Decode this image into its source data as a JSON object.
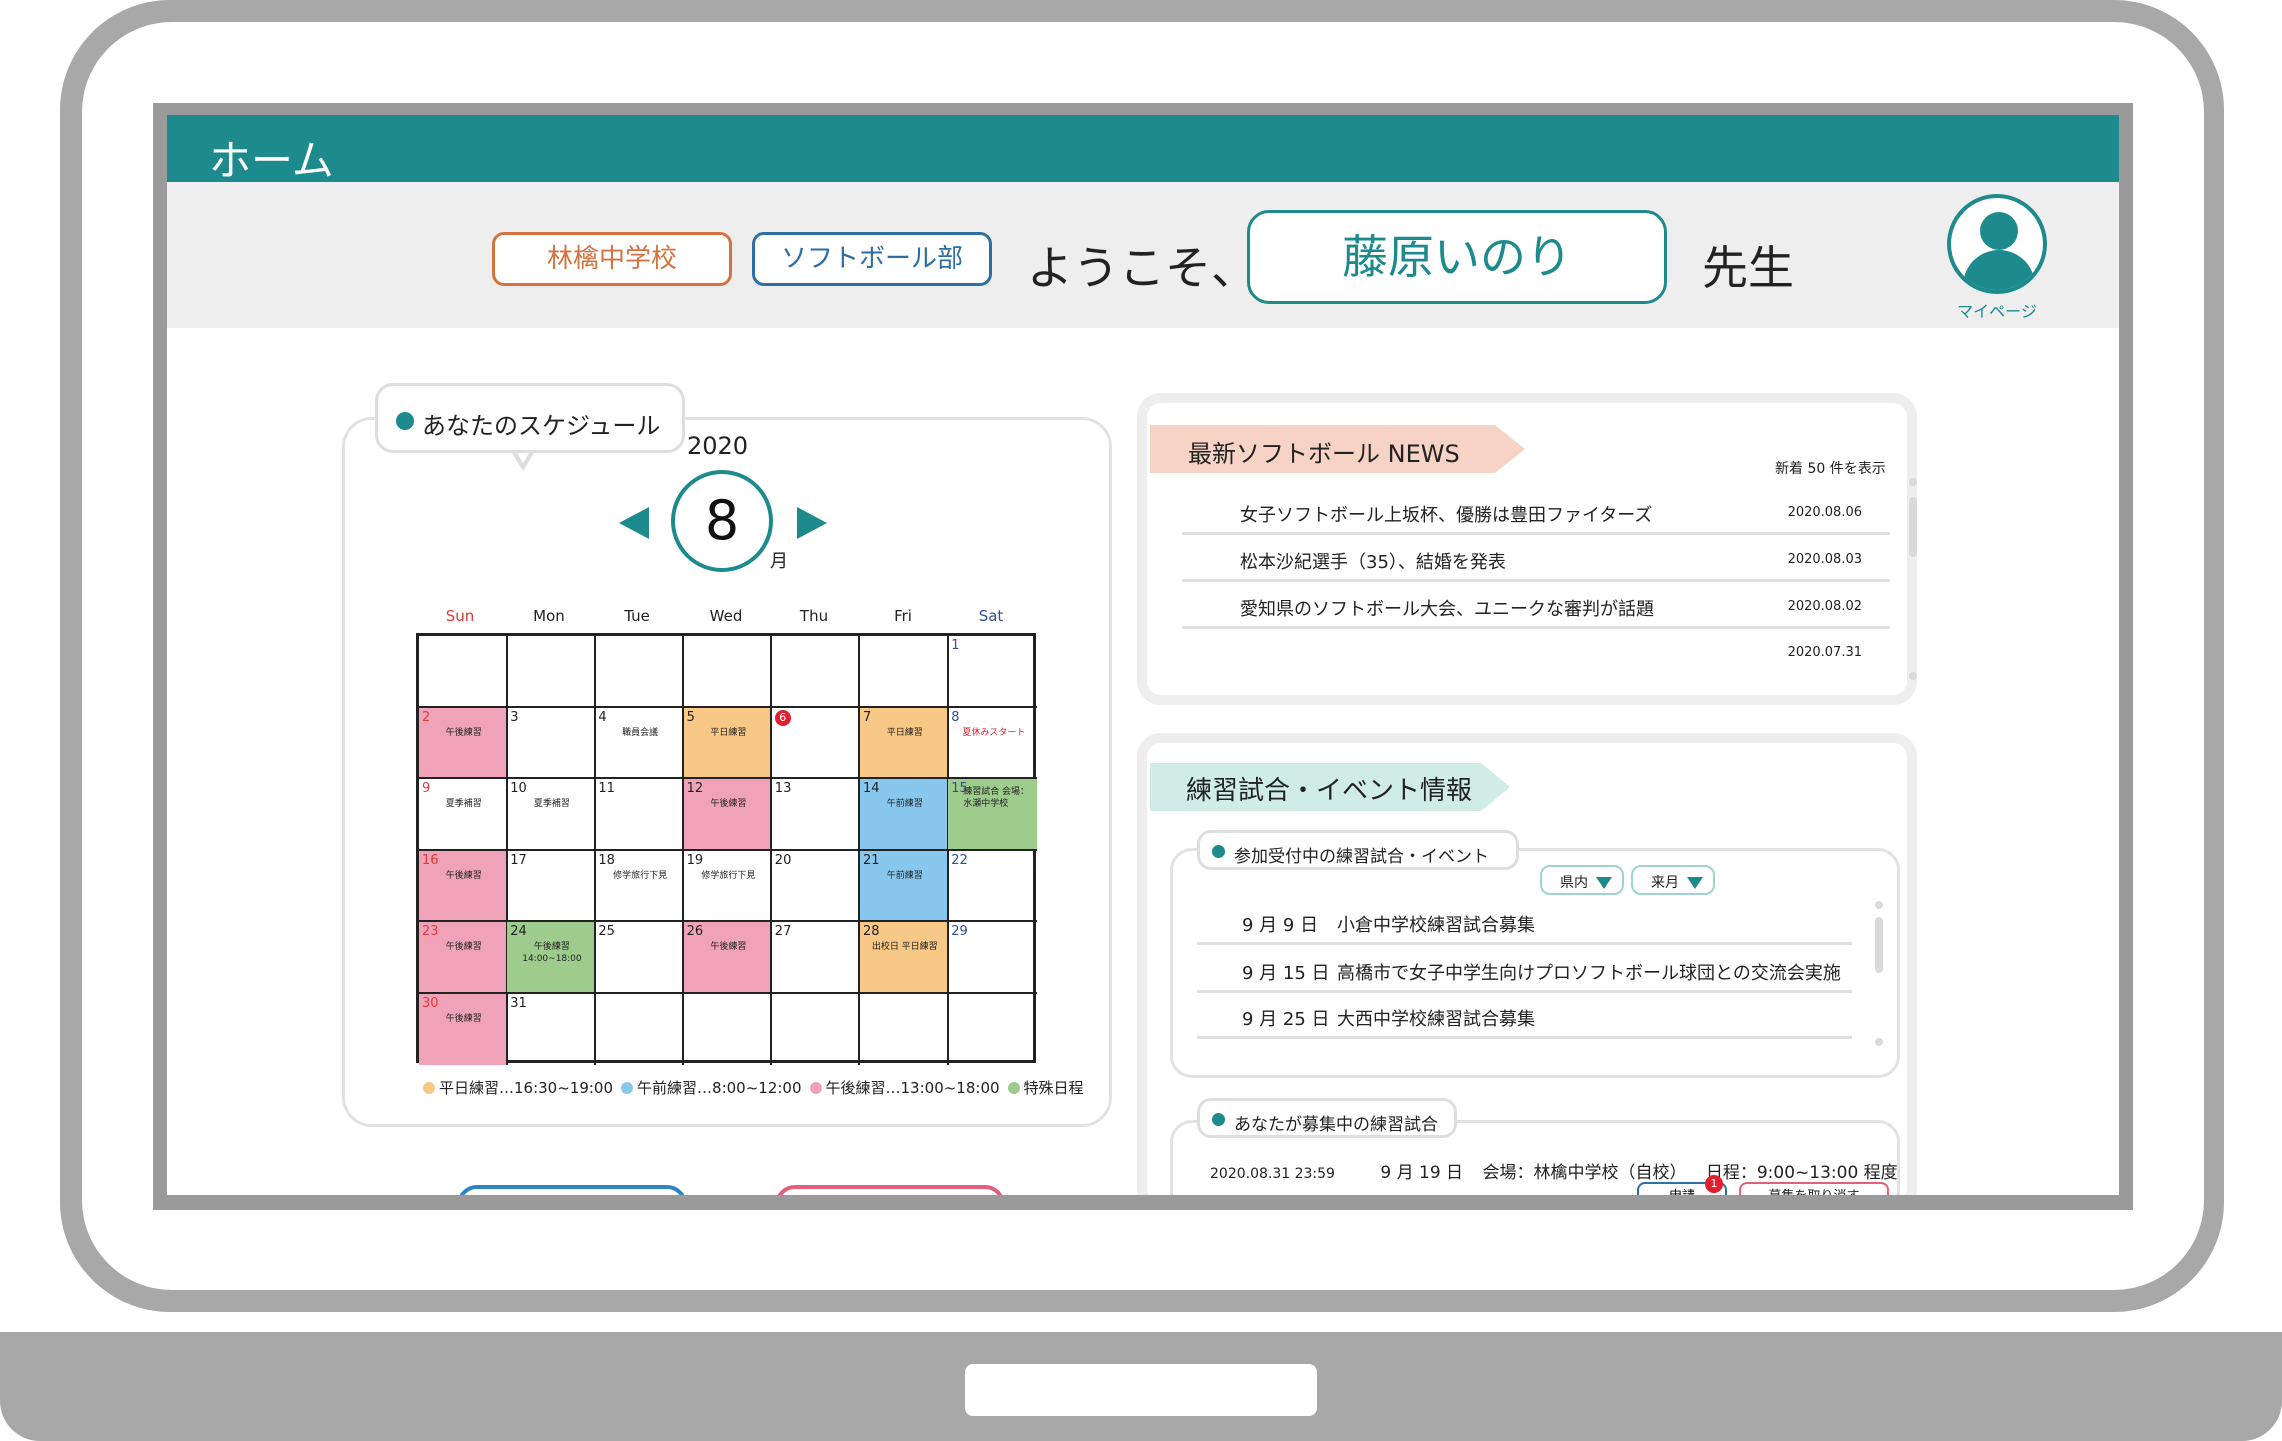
{
  "header": {
    "title": "ホーム"
  },
  "welcome": {
    "school": "林檎中学校",
    "club": "ソフトボール部",
    "greeting": "ようこそ、",
    "name": "藤原いのり",
    "honorific": "先生",
    "mypage_label": "マイページ"
  },
  "schedule": {
    "tab_label": "あなたのスケジュール",
    "year": "2020",
    "month": "8",
    "month_suffix": "月",
    "weekdays": [
      "Sun",
      "Mon",
      "Tue",
      "Wed",
      "Thu",
      "Fri",
      "Sat"
    ],
    "weekday_colors": [
      "#e03c3c",
      "#222222",
      "#222222",
      "#222222",
      "#222222",
      "#222222",
      "#2e4f9e"
    ],
    "cells": [
      {
        "n": "",
        "t": "",
        "c": ""
      },
      {
        "n": "",
        "t": "",
        "c": ""
      },
      {
        "n": "",
        "t": "",
        "c": ""
      },
      {
        "n": "",
        "t": "",
        "c": ""
      },
      {
        "n": "",
        "t": "",
        "c": ""
      },
      {
        "n": "",
        "t": "",
        "c": ""
      },
      {
        "n": "1",
        "t": "",
        "c": ""
      },
      {
        "n": "2",
        "t": "午後練習",
        "c": "pink"
      },
      {
        "n": "3",
        "t": "",
        "c": ""
      },
      {
        "n": "4",
        "t": "職員会議",
        "c": ""
      },
      {
        "n": "5",
        "t": "平日練習",
        "c": "orange"
      },
      {
        "n": "6",
        "t": "",
        "c": "",
        "badge": true
      },
      {
        "n": "7",
        "t": "平日練習",
        "c": "orange"
      },
      {
        "n": "8",
        "t": "夏休みスタート",
        "c": "",
        "red": true
      },
      {
        "n": "9",
        "t": "夏季補習",
        "c": ""
      },
      {
        "n": "10",
        "t": "夏季補習",
        "c": ""
      },
      {
        "n": "11",
        "t": "",
        "c": ""
      },
      {
        "n": "12",
        "t": "午後練習",
        "c": "pink"
      },
      {
        "n": "13",
        "t": "",
        "c": ""
      },
      {
        "n": "14",
        "t": "午前練習",
        "c": "blue"
      },
      {
        "n": "15",
        "t": "練習試合 会場：水瀬中学校",
        "c": "green"
      },
      {
        "n": "16",
        "t": "午後練習",
        "c": "pink"
      },
      {
        "n": "17",
        "t": "",
        "c": ""
      },
      {
        "n": "18",
        "t": "修学旅行下見",
        "c": ""
      },
      {
        "n": "19",
        "t": "修学旅行下見",
        "c": ""
      },
      {
        "n": "20",
        "t": "",
        "c": ""
      },
      {
        "n": "21",
        "t": "午前練習",
        "c": "blue"
      },
      {
        "n": "22",
        "t": "",
        "c": ""
      },
      {
        "n": "23",
        "t": "午後練習",
        "c": "pink"
      },
      {
        "n": "24",
        "t": "午後練習 14:00~18:00",
        "c": "green"
      },
      {
        "n": "25",
        "t": "",
        "c": ""
      },
      {
        "n": "26",
        "t": "午後練習",
        "c": "pink"
      },
      {
        "n": "27",
        "t": "",
        "c": ""
      },
      {
        "n": "28",
        "t": "出校日 平日練習",
        "c": "orange",
        "redtop": true
      },
      {
        "n": "29",
        "t": "",
        "c": ""
      },
      {
        "n": "30",
        "t": "午後練習",
        "c": "pink"
      },
      {
        "n": "31",
        "t": "",
        "c": ""
      },
      {
        "n": "",
        "t": "",
        "c": ""
      },
      {
        "n": "",
        "t": "",
        "c": ""
      },
      {
        "n": "",
        "t": "",
        "c": ""
      },
      {
        "n": "",
        "t": "",
        "c": ""
      },
      {
        "n": "",
        "t": "",
        "c": ""
      }
    ],
    "legend": [
      {
        "label": "平日練習…16:30~19:00",
        "color": "#f7c886"
      },
      {
        "label": "午前練習…8:00~12:00",
        "color": "#88c8ee"
      },
      {
        "label": "午後練習…13:00~18:00",
        "color": "#f0a3b8"
      },
      {
        "label": "特殊日程",
        "color": "#9dcc8c"
      }
    ]
  },
  "colors": {
    "pink": "#f0a3b8",
    "orange": "#f7c886",
    "blue": "#88c8ee",
    "green": "#9dcc8c",
    "accent": "#1d8a8d"
  },
  "news": {
    "tag": "最新ソフトボール NEWS",
    "count_label": "新着 50 件を表示",
    "items": [
      {
        "title": "女子ソフトボール上坂杯、優勝は豊田ファイターズ",
        "date": "2020.08.06"
      },
      {
        "title": "松本沙紀選手（35）、結婚を発表",
        "date": "2020.08.03"
      },
      {
        "title": "愛知県のソフトボール大会、ユニークな審判が話題",
        "date": "2020.08.02"
      },
      {
        "title": "",
        "date": "2020.07.31"
      }
    ]
  },
  "events": {
    "tag": "練習試合・イベント情報",
    "open_tab": "参加受付中の練習試合・イベント",
    "filter_area": "県内",
    "filter_month": "来月",
    "items": [
      {
        "date": "9 月  9 日",
        "title": "小倉中学校練習試合募集"
      },
      {
        "date": "9 月 15 日",
        "title": "高橋市で女子中学生向けプロソフトボール球団との交流会実施"
      },
      {
        "date": "9 月 25 日",
        "title": "大西中学校練習試合募集"
      }
    ],
    "recruit_tab": "あなたが募集中の練習試合",
    "recruit": {
      "posted": "2020.08.31 23:59",
      "date": "9 月 19 日",
      "venue": "会場：林檎中学校（自校）",
      "schedule": "日程：9:00~13:00 程度",
      "apply_label": "申請",
      "badge": "1",
      "cancel_label": "募集を取り消す"
    }
  }
}
